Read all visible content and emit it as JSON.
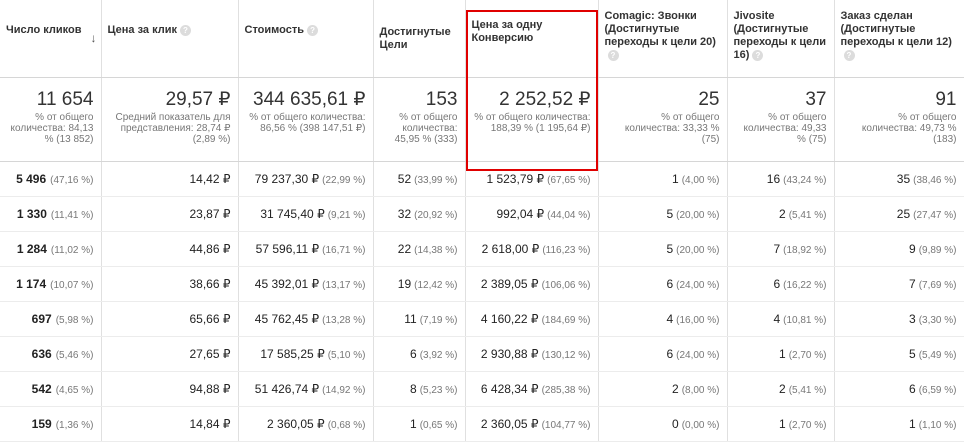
{
  "headers": [
    {
      "label": "Число кликов",
      "help": false,
      "sort": "↓"
    },
    {
      "label": "Цена за клик",
      "help": true
    },
    {
      "label": "Стоимость",
      "help": true
    },
    {
      "label": "Достигнутые Цели",
      "help": false
    },
    {
      "label": "Цена за одну Конверсию",
      "help": false
    },
    {
      "label": "Comagic: Звонки (Достигнутые переходы к цели 20)",
      "help": true
    },
    {
      "label": "Jivosite (Достигнутые переходы к цели 16)",
      "help": true
    },
    {
      "label": "Заказ сделан (Достигнутые переходы к цели 12)",
      "help": true
    }
  ],
  "help_glyph": "?",
  "totals": [
    {
      "value": "11 654",
      "sub": "% от общего количества: 84,13 % (13 852)"
    },
    {
      "value": "29,57 ₽",
      "sub": "Средний показатель для представления: 28,74 ₽ (2,89 %)"
    },
    {
      "value": "344 635,61 ₽",
      "sub": "% от общего количества: 86,56 % (398 147,51 ₽)"
    },
    {
      "value": "153",
      "sub": "% от общего количества: 45,95 % (333)"
    },
    {
      "value": "2 252,52 ₽",
      "sub": "% от общего количества: 188,39 % (1 195,64 ₽)"
    },
    {
      "value": "25",
      "sub": "% от общего количества: 33,33 % (75)"
    },
    {
      "value": "37",
      "sub": "% от общего количества: 49,33 % (75)"
    },
    {
      "value": "91",
      "sub": "% от общего количества: 49,73 % (183)"
    }
  ],
  "rows": [
    [
      {
        "v": "5 496",
        "p": "(47,16 %)"
      },
      {
        "v": "14,42 ₽",
        "p": ""
      },
      {
        "v": "79 237,30 ₽",
        "p": "(22,99 %)"
      },
      {
        "v": "52",
        "p": "(33,99 %)"
      },
      {
        "v": "1 523,79 ₽",
        "p": "(67,65 %)"
      },
      {
        "v": "1",
        "p": "(4,00 %)"
      },
      {
        "v": "16",
        "p": "(43,24 %)"
      },
      {
        "v": "35",
        "p": "(38,46 %)"
      }
    ],
    [
      {
        "v": "1 330",
        "p": "(11,41 %)"
      },
      {
        "v": "23,87 ₽",
        "p": ""
      },
      {
        "v": "31 745,40 ₽",
        "p": "(9,21 %)"
      },
      {
        "v": "32",
        "p": "(20,92 %)"
      },
      {
        "v": "992,04 ₽",
        "p": "(44,04 %)"
      },
      {
        "v": "5",
        "p": "(20,00 %)"
      },
      {
        "v": "2",
        "p": "(5,41 %)"
      },
      {
        "v": "25",
        "p": "(27,47 %)"
      }
    ],
    [
      {
        "v": "1 284",
        "p": "(11,02 %)"
      },
      {
        "v": "44,86 ₽",
        "p": ""
      },
      {
        "v": "57 596,11 ₽",
        "p": "(16,71 %)"
      },
      {
        "v": "22",
        "p": "(14,38 %)"
      },
      {
        "v": "2 618,00 ₽",
        "p": "(116,23 %)"
      },
      {
        "v": "5",
        "p": "(20,00 %)"
      },
      {
        "v": "7",
        "p": "(18,92 %)"
      },
      {
        "v": "9",
        "p": "(9,89 %)"
      }
    ],
    [
      {
        "v": "1 174",
        "p": "(10,07 %)"
      },
      {
        "v": "38,66 ₽",
        "p": ""
      },
      {
        "v": "45 392,01 ₽",
        "p": "(13,17 %)"
      },
      {
        "v": "19",
        "p": "(12,42 %)"
      },
      {
        "v": "2 389,05 ₽",
        "p": "(106,06 %)"
      },
      {
        "v": "6",
        "p": "(24,00 %)"
      },
      {
        "v": "6",
        "p": "(16,22 %)"
      },
      {
        "v": "7",
        "p": "(7,69 %)"
      }
    ],
    [
      {
        "v": "697",
        "p": "(5,98 %)"
      },
      {
        "v": "65,66 ₽",
        "p": ""
      },
      {
        "v": "45 762,45 ₽",
        "p": "(13,28 %)"
      },
      {
        "v": "11",
        "p": "(7,19 %)"
      },
      {
        "v": "4 160,22 ₽",
        "p": "(184,69 %)"
      },
      {
        "v": "4",
        "p": "(16,00 %)"
      },
      {
        "v": "4",
        "p": "(10,81 %)"
      },
      {
        "v": "3",
        "p": "(3,30 %)"
      }
    ],
    [
      {
        "v": "636",
        "p": "(5,46 %)"
      },
      {
        "v": "27,65 ₽",
        "p": ""
      },
      {
        "v": "17 585,25 ₽",
        "p": "(5,10 %)"
      },
      {
        "v": "6",
        "p": "(3,92 %)"
      },
      {
        "v": "2 930,88 ₽",
        "p": "(130,12 %)"
      },
      {
        "v": "6",
        "p": "(24,00 %)"
      },
      {
        "v": "1",
        "p": "(2,70 %)"
      },
      {
        "v": "5",
        "p": "(5,49 %)"
      }
    ],
    [
      {
        "v": "542",
        "p": "(4,65 %)"
      },
      {
        "v": "94,88 ₽",
        "p": ""
      },
      {
        "v": "51 426,74 ₽",
        "p": "(14,92 %)"
      },
      {
        "v": "8",
        "p": "(5,23 %)"
      },
      {
        "v": "6 428,34 ₽",
        "p": "(285,38 %)"
      },
      {
        "v": "2",
        "p": "(8,00 %)"
      },
      {
        "v": "2",
        "p": "(5,41 %)"
      },
      {
        "v": "6",
        "p": "(6,59 %)"
      }
    ],
    [
      {
        "v": "159",
        "p": "(1,36 %)"
      },
      {
        "v": "14,84 ₽",
        "p": ""
      },
      {
        "v": "2 360,05 ₽",
        "p": "(0,68 %)"
      },
      {
        "v": "1",
        "p": "(0,65 %)"
      },
      {
        "v": "2 360,05 ₽",
        "p": "(104,77 %)"
      },
      {
        "v": "0",
        "p": "(0,00 %)"
      },
      {
        "v": "1",
        "p": "(2,70 %)"
      },
      {
        "v": "1",
        "p": "(1,10 %)"
      }
    ]
  ],
  "highlight_color": "#e00000"
}
